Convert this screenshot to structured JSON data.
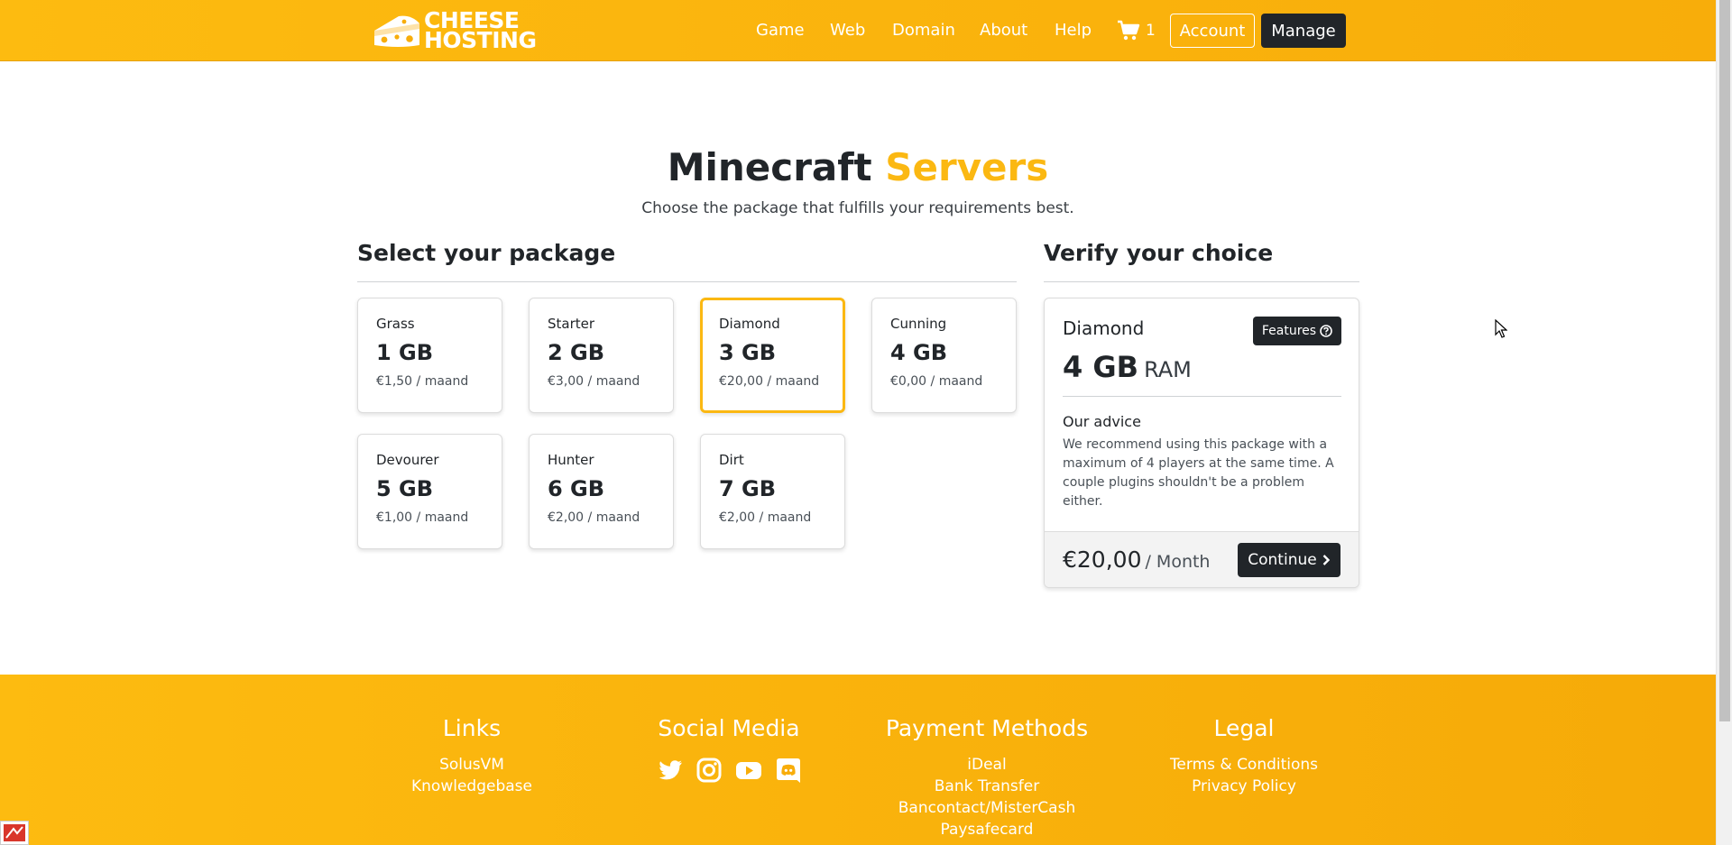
{
  "brand": {
    "line1": "CHEESE",
    "line2": "HOSTING"
  },
  "nav": {
    "items": [
      {
        "id": "game",
        "label": "Game"
      },
      {
        "id": "web",
        "label": "Web"
      },
      {
        "id": "domain",
        "label": "Domain"
      },
      {
        "id": "about",
        "label": "About"
      },
      {
        "id": "help",
        "label": "Help"
      }
    ],
    "cart_count": "1",
    "account_label": "Account",
    "manage_label": "Manage"
  },
  "hero": {
    "title_main": "Minecraft",
    "title_accent": "Servers",
    "subtitle": "Choose the package that fulfills your requirements best."
  },
  "packages": {
    "heading": "Select your package",
    "selected": "Diamond",
    "items": [
      {
        "name": "Grass",
        "size": "1 GB",
        "price": "€1,50 / maand"
      },
      {
        "name": "Starter",
        "size": "2 GB",
        "price": "€3,00 / maand"
      },
      {
        "name": "Diamond",
        "size": "3 GB",
        "price": "€20,00 / maand"
      },
      {
        "name": "Cunning",
        "size": "4 GB",
        "price": "€0,00 / maand"
      },
      {
        "name": "Devourer",
        "size": "5 GB",
        "price": "€1,00 / maand"
      },
      {
        "name": "Hunter",
        "size": "6 GB",
        "price": "€2,00 / maand"
      },
      {
        "name": "Dirt",
        "size": "7 GB",
        "price": "€2,00 / maand"
      }
    ]
  },
  "verify": {
    "heading": "Verify your choice",
    "package_name": "Diamond",
    "features_label": "Features",
    "ram_value": "4 GB",
    "ram_unit": "RAM",
    "advice_heading": "Our advice",
    "advice_text": "We recommend using this package with a maximum of 4 players at the same time. A couple plugins shouldn't be a problem either.",
    "price": "€20,00",
    "period": "/ Month",
    "continue_label": "Continue"
  },
  "footer": {
    "links": {
      "heading": "Links",
      "items": [
        "SolusVM",
        "Knowledgebase"
      ]
    },
    "social": {
      "heading": "Social Media",
      "icons": [
        "twitter-icon",
        "instagram-icon",
        "youtube-icon",
        "discord-icon"
      ]
    },
    "payment": {
      "heading": "Payment Methods",
      "items": [
        "iDeal",
        "Bank Transfer",
        "Bancontact/MisterCash",
        "Paysafecard"
      ]
    },
    "legal": {
      "heading": "Legal",
      "items": [
        "Terms & Conditions",
        "Privacy Policy"
      ]
    }
  },
  "colors": {
    "accent": "#fbb812",
    "dark": "#212529",
    "selected_border": "#fbb812"
  }
}
